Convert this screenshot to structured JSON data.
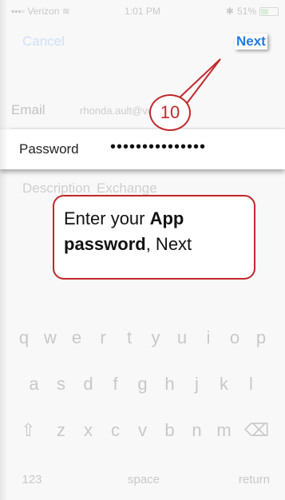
{
  "status_bar": {
    "carrier": "Verizon",
    "time": "1:01 PM",
    "battery": "51%",
    "battery_level": 0.51
  },
  "nav": {
    "cancel": "Cancel",
    "next": "Next"
  },
  "form": {
    "email_label": "Email",
    "email_value": "rhonda.ault@vermo...",
    "password_label": "Password",
    "password_value": "•••••••••••••••",
    "description_label": "Description",
    "description_value": "Exchange"
  },
  "callout": {
    "step": "10",
    "text_pre": "Enter your ",
    "text_bold": "App password",
    "text_post": ", Next",
    "color": "#c0282b"
  },
  "keyboard": {
    "row1": [
      "q",
      "w",
      "e",
      "r",
      "t",
      "y",
      "u",
      "i",
      "o",
      "p"
    ],
    "row2": [
      "a",
      "s",
      "d",
      "f",
      "g",
      "h",
      "j",
      "k",
      "l"
    ],
    "row3": [
      "z",
      "x",
      "c",
      "v",
      "b",
      "n",
      "m"
    ],
    "shift_icon": "shift-icon",
    "delete_icon": "delete-icon",
    "numbers": "123",
    "space": "space",
    "return": "return"
  },
  "accent": "#1f7be0"
}
